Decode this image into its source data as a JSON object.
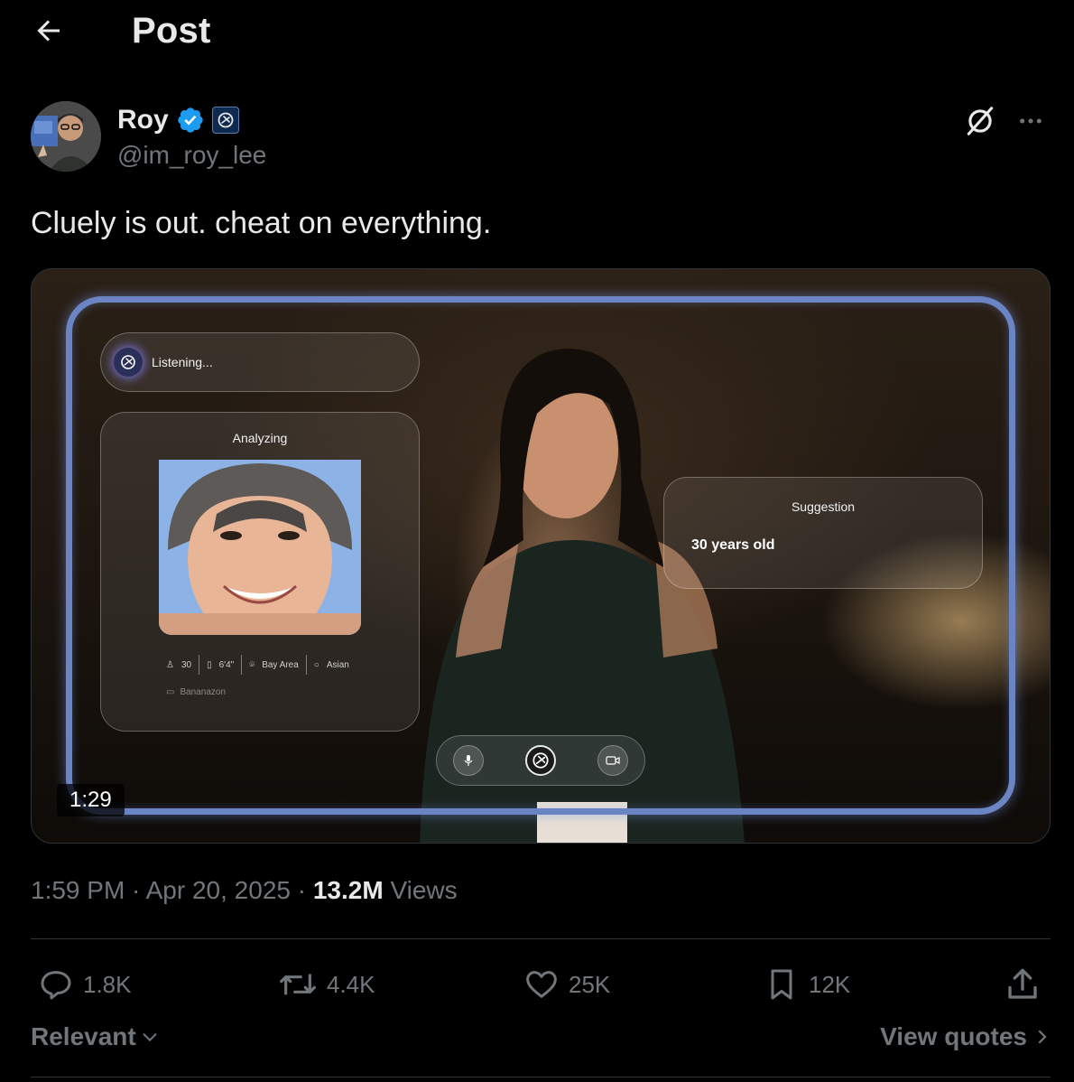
{
  "header": {
    "title": "Post"
  },
  "author": {
    "display_name": "Roy",
    "handle": "@im_roy_lee"
  },
  "post": {
    "text": "Cluely is out. cheat on everything.",
    "timestamp": "1:59 PM · Apr 20, 2025 · ",
    "views_count": "13.2M",
    "views_label": " Views"
  },
  "media": {
    "duration": "1:29",
    "overlay": {
      "listening": "Listening...",
      "analyzing_title": "Analyzing",
      "stats": {
        "age": "30",
        "height": "6'4\"",
        "location": "Bay Area",
        "ethnicity": "Asian"
      },
      "job": "Bananazon",
      "suggestion_title": "Suggestion",
      "suggestion_text": "30 years old"
    }
  },
  "actions": {
    "replies": "1.8K",
    "reposts": "4.4K",
    "likes": "25K",
    "bookmarks": "12K"
  },
  "filters": {
    "sort": "Relevant",
    "view_quotes": "View quotes"
  },
  "colors": {
    "background": "#000000",
    "text_primary": "#e7e9ea",
    "text_secondary": "#71767b",
    "verified": "#1d9bf0",
    "frame": "#6b84c4"
  }
}
